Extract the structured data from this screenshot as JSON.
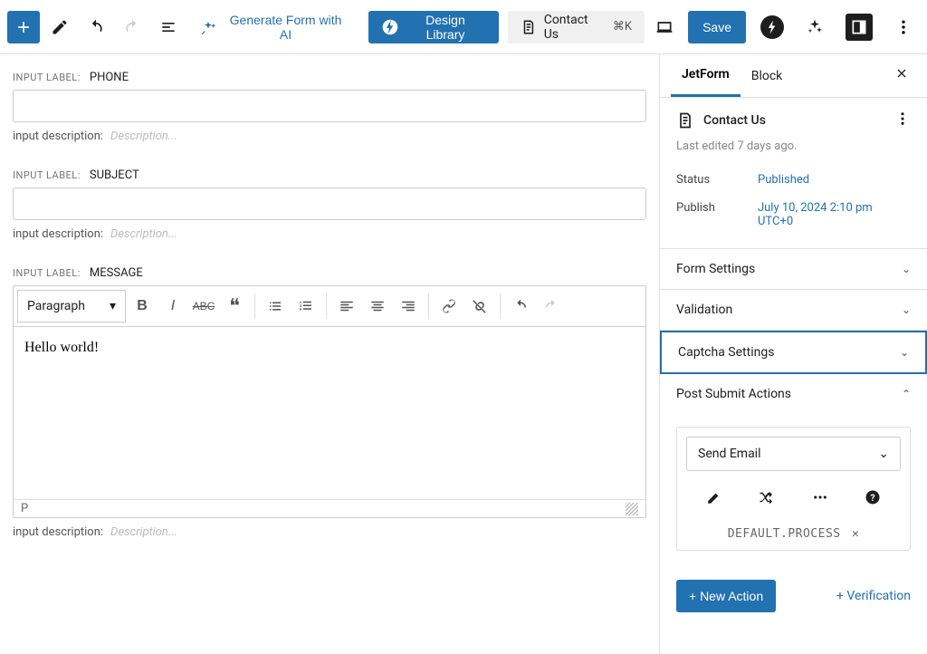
{
  "toolbar": {
    "generate_ai": "Generate Form with AI",
    "design_library": "Design Library",
    "doc_title": "Contact Us",
    "doc_shortcut": "⌘K",
    "save": "Save"
  },
  "fields": [
    {
      "label_prefix": "INPUT LABEL:",
      "label": "PHONE",
      "value": "",
      "desc_label": "input description:",
      "desc_placeholder": "Description..."
    },
    {
      "label_prefix": "INPUT LABEL:",
      "label": "SUBJECT",
      "value": "",
      "desc_label": "input description:",
      "desc_placeholder": "Description..."
    },
    {
      "label_prefix": "INPUT LABEL:",
      "label": "MESSAGE",
      "value": "",
      "desc_label": "input description:",
      "desc_placeholder": "Description..."
    }
  ],
  "rich_editor": {
    "format_label": "Paragraph",
    "content": "Hello world!",
    "status_path": "P"
  },
  "sidebar": {
    "tabs": {
      "jetform": "JetForm",
      "block": "Block"
    },
    "doc_title": "Contact Us",
    "last_edited": "Last edited 7 days ago.",
    "status_label": "Status",
    "status_value": "Published",
    "publish_label": "Publish",
    "publish_value": "July 10, 2024 2:10 pm UTC+0",
    "panels": {
      "form_settings": "Form Settings",
      "validation": "Validation",
      "captcha": "Captcha Settings",
      "post_submit": "Post Submit Actions"
    },
    "action": {
      "selected": "Send Email",
      "tag": "DEFAULT.PROCESS",
      "tag_close": "✕"
    },
    "new_action": "+ New Action",
    "verification": "+ Verification"
  }
}
